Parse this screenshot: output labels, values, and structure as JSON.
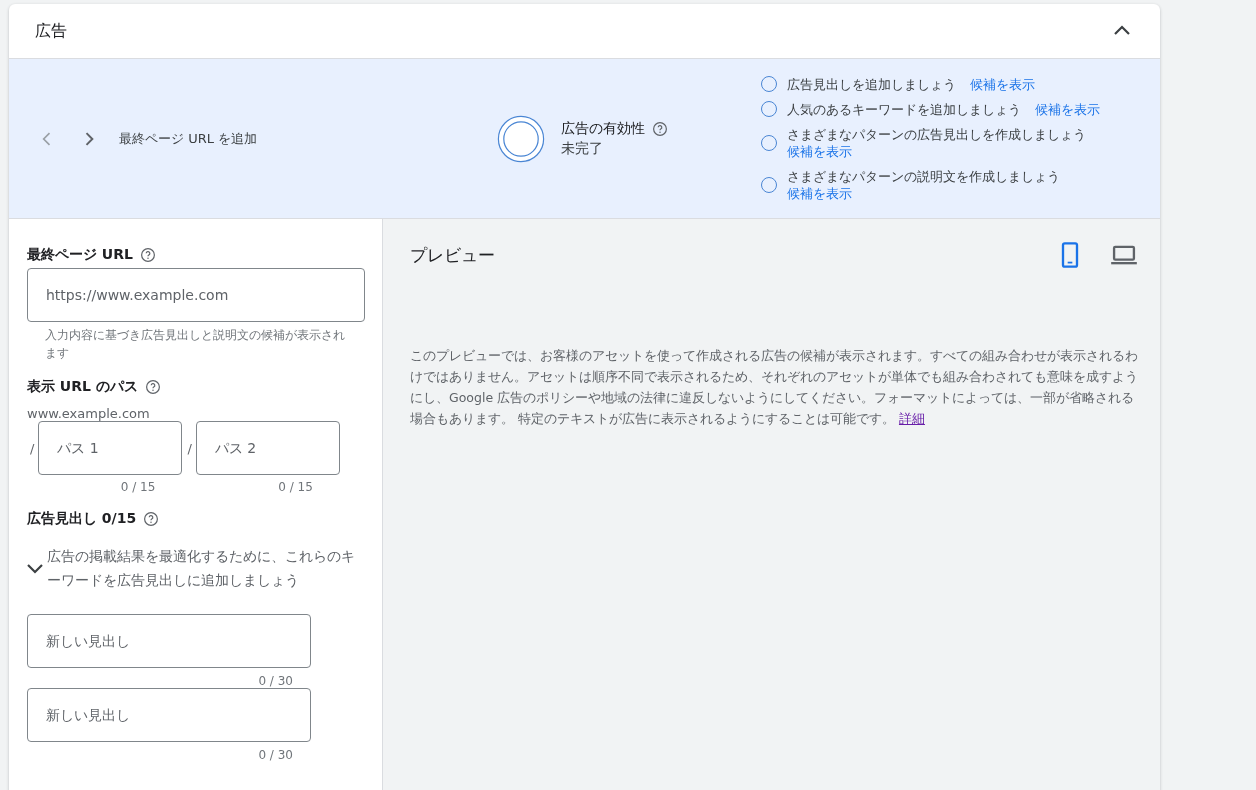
{
  "panel": {
    "title": "広告",
    "expanded": true
  },
  "banner": {
    "step_label": "最終ページ URL を追加",
    "strength": {
      "title": "広告の有効性",
      "status": "未完了"
    },
    "suggestions": [
      {
        "text": "広告見出しを追加しましょう",
        "link": "候補を表示",
        "kind": "inline",
        "checked": false
      },
      {
        "text": "人気のあるキーワードを追加しましょう",
        "link": "候補を表示",
        "kind": "inline",
        "checked": false
      },
      {
        "text": "さまざまなパターンの広告見出しを作成しましょう",
        "link": "候補を表示",
        "kind": "stacked",
        "checked": false
      },
      {
        "text": "さまざまなパターンの説明文を作成しましょう",
        "link": "候補を表示",
        "kind": "stacked",
        "checked": false
      }
    ]
  },
  "form": {
    "final_url": {
      "label": "最終ページ URL",
      "placeholder": "https://www.example.com",
      "hint": "入力内容に基づき広告見出しと説明文の候補が表示されます"
    },
    "display_path": {
      "label": "表示 URL のパス",
      "domain": "www.example.com",
      "paths": [
        {
          "separator": "/",
          "placeholder": "パス 1",
          "counter": "0 / 15"
        },
        {
          "separator": "/",
          "placeholder": "パス 2",
          "counter": "0 / 15"
        }
      ]
    },
    "headlines": {
      "label": "広告見出し 0/15",
      "keyword_tip": "広告の掲載結果を最適化するために、これらのキーワードを広告見出しに追加しましょう",
      "tip_expanded": false,
      "fields": [
        {
          "placeholder": "新しい見出し",
          "counter": "0 / 30"
        },
        {
          "placeholder": "新しい見出し",
          "counter": "0 / 30"
        }
      ]
    }
  },
  "preview": {
    "title": "プレビュー",
    "devices": [
      {
        "kind": "mobile",
        "selected": true
      },
      {
        "kind": "desktop",
        "selected": false
      }
    ],
    "notice": "このプレビューでは、お客様のアセットを使って作成される広告の候補が表示されます。すべての組み合わせが表示されるわけではありません。アセットは順序不同で表示されるため、それぞれのアセットが単体でも組み合わされても意味を成すようにし、Google 広告のポリシーや地域の法律に違反しないようにしてください。フォーマットによっては、一部が省略される場合もあります。 特定のテキストが広告に表示されるようにすることは可能です。",
    "notice_link": "詳細"
  }
}
